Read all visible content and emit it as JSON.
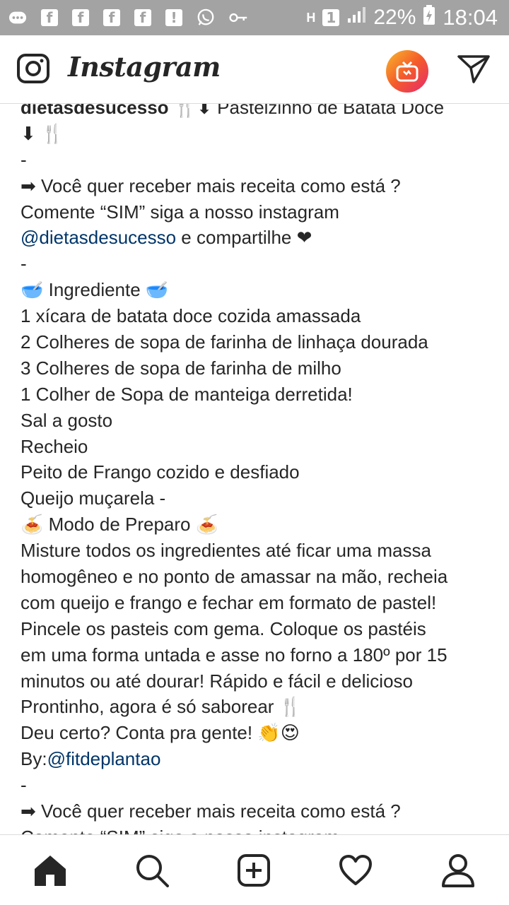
{
  "status_bar": {
    "left_icons": [
      "chat-icon",
      "facebook-icon",
      "facebook-icon",
      "facebook-icon",
      "alert-icon",
      "whatsapp-icon",
      "key-icon"
    ],
    "network": "H",
    "sim": "1",
    "battery": "22%",
    "time": "18:04"
  },
  "header": {
    "app_name": "Instagram"
  },
  "post": {
    "username": "dietasdesucesso",
    "lines": [
      {
        "type": "first",
        "text": " 🍴⬇ Pastelzinho de Batata Doce"
      },
      {
        "type": "text",
        "text": "⬇ 🍴"
      },
      {
        "type": "text",
        "text": "-"
      },
      {
        "type": "text",
        "text": "➡ Você quer receber mais receita como está ?"
      },
      {
        "type": "text",
        "text": "Comente “SIM” siga a nosso instagram"
      },
      {
        "type": "mention_line",
        "mention": "@dietasdesucesso",
        "text": " e compartilhe ❤"
      },
      {
        "type": "text",
        "text": "-"
      },
      {
        "type": "text",
        "text": "🥣 Ingrediente 🥣"
      },
      {
        "type": "text",
        "text": "1 xícara de batata doce cozida amassada"
      },
      {
        "type": "text",
        "text": "2 Colheres de sopa de farinha de linhaça dourada"
      },
      {
        "type": "text",
        "text": "3 Colheres de sopa de farinha de milho"
      },
      {
        "type": "text",
        "text": "1 Colher de Sopa de manteiga derretida!"
      },
      {
        "type": "text",
        "text": "Sal a gosto"
      },
      {
        "type": "text",
        "text": "Recheio"
      },
      {
        "type": "text",
        "text": "Peito de Frango cozido e desfiado"
      },
      {
        "type": "text",
        "text": "Queijo muçarela -"
      },
      {
        "type": "text",
        "text": "🍝 Modo de Preparo 🍝"
      },
      {
        "type": "text",
        "text": "Misture todos os ingredientes até ficar uma massa"
      },
      {
        "type": "text",
        "text": "homogêneo e no ponto de amassar na mão, recheia"
      },
      {
        "type": "text",
        "text": "com queijo e frango e fechar em formato de pastel!"
      },
      {
        "type": "text",
        "text": "Pincele os pasteis com gema. Coloque os pastéis"
      },
      {
        "type": "text",
        "text": "em uma forma untada e asse no forno a 180º por 15"
      },
      {
        "type": "text",
        "text": "minutos ou até dourar! Rápido e fácil e delicioso"
      },
      {
        "type": "text",
        "text": "Prontinho, agora é só saborear 🍴"
      },
      {
        "type": "text",
        "text": "Deu certo? Conta pra gente! 👏😍"
      },
      {
        "type": "prefix_mention",
        "text": "By:",
        "mention": "@fitdeplantao"
      },
      {
        "type": "text",
        "text": "-"
      },
      {
        "type": "text",
        "text": "➡ Você quer receber mais receita como está ?"
      },
      {
        "type": "text",
        "text": "Comente “SIM” siga a nosso instagram"
      }
    ]
  },
  "bottom_nav": {
    "items": [
      "home-icon",
      "search-icon",
      "new-post-icon",
      "activity-icon",
      "profile-icon"
    ]
  },
  "colors": {
    "status_bar_bg": "#a3a3a3",
    "mention": "#003569",
    "text": "#262626"
  }
}
